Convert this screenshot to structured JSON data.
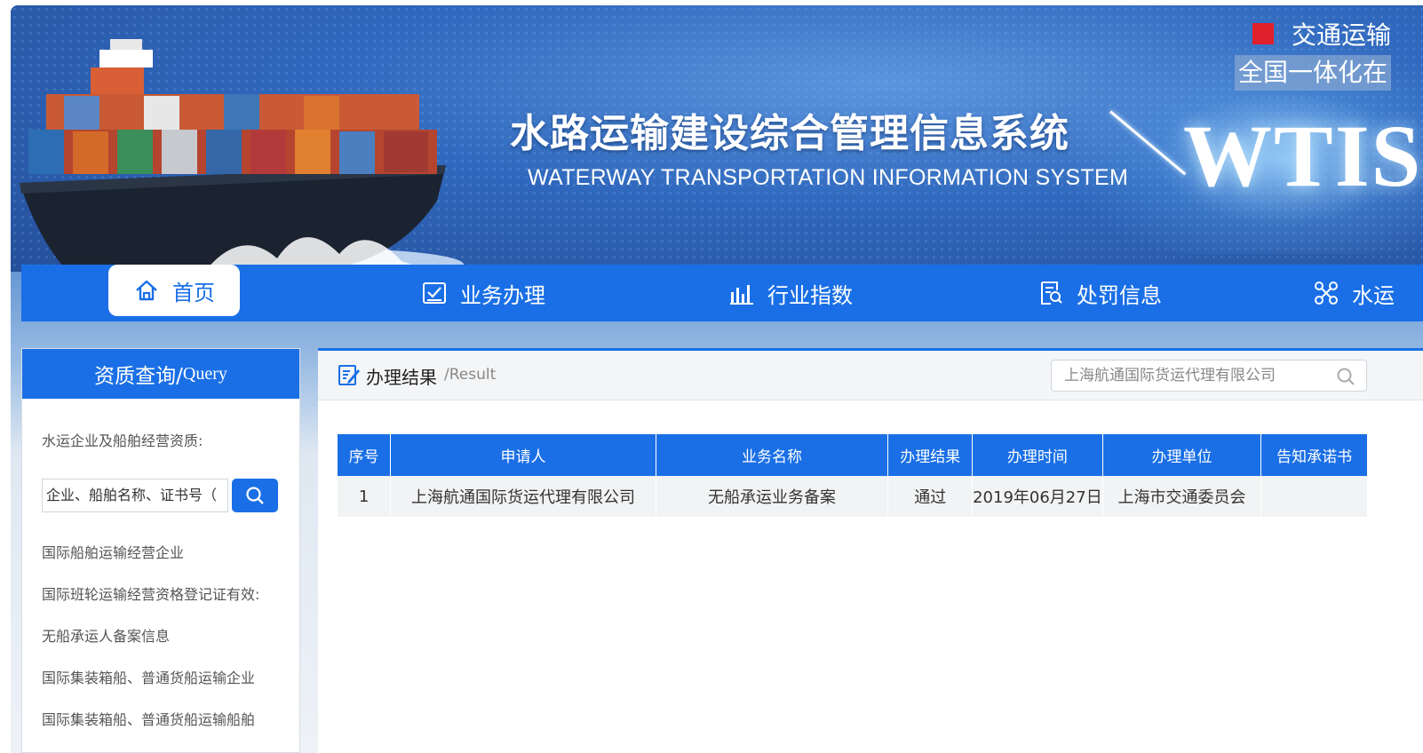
{
  "banner": {
    "title": "水路运输建设综合管理信息系统",
    "subtitle": "WATERWAY TRANSPORTATION INFORMATION SYSTEM",
    "logo_text": "WTIS",
    "top_right_line1": "交通运输",
    "top_right_line2": "全国一体化在"
  },
  "nav": {
    "items": [
      {
        "label": "首页",
        "icon": "home-icon"
      },
      {
        "label": "业务办理",
        "icon": "checklist-icon"
      },
      {
        "label": "行业指数",
        "icon": "bar-chart-icon"
      },
      {
        "label": "处罚信息",
        "icon": "document-search-icon"
      },
      {
        "label": "水运",
        "icon": "network-icon"
      }
    ]
  },
  "sidebar": {
    "title_zh": "资质查询/",
    "title_en": "Query",
    "label": "水运企业及船舶经营资质:",
    "search_value": "企业、船舶名称、证书号（",
    "items": [
      "国际船舶运输经营企业",
      "国际班轮运输经营资格登记证有效:",
      "无船承运人备案信息",
      "国际集装箱船、普通货船运输企业",
      "国际集装箱船、普通货船运输船舶"
    ]
  },
  "main": {
    "title_zh": "办理结果",
    "title_en": "/Result",
    "search_placeholder": "上海航通国际货运代理有限公司",
    "table": {
      "headers": [
        "序号",
        "申请人",
        "业务名称",
        "办理结果",
        "办理时间",
        "办理单位",
        "告知承诺书"
      ],
      "rows": [
        [
          "1",
          "上海航通国际货运代理有限公司",
          "无船承运业务备案",
          "通过",
          "2019年06月27日",
          "上海市交通委员会",
          ""
        ]
      ]
    }
  },
  "colors": {
    "primary": "#1a6fe6",
    "accent_red": "#e0202a"
  }
}
